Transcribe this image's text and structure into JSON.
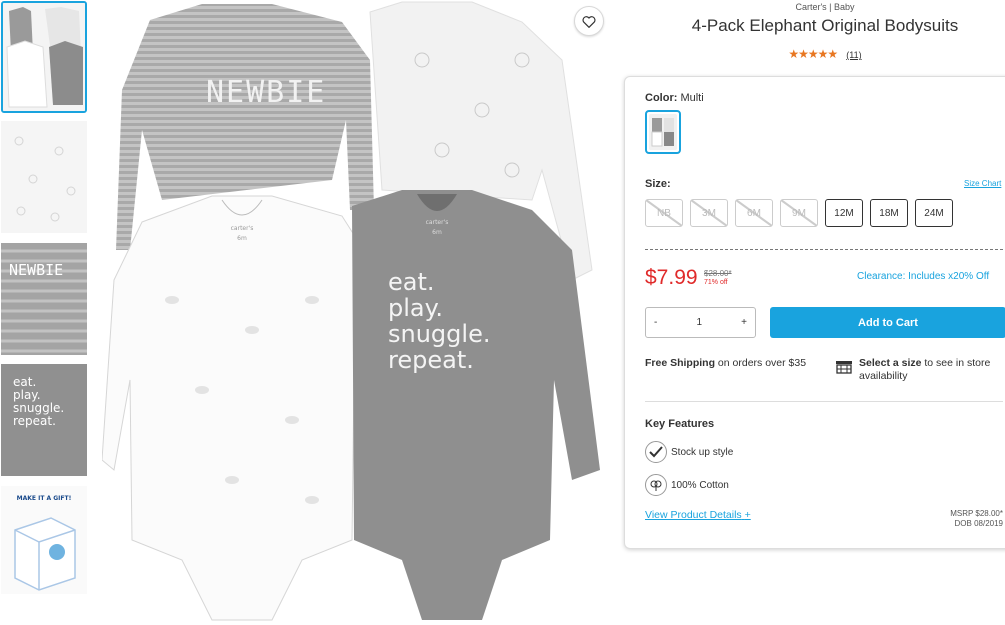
{
  "product": {
    "brand": "Carter's | Baby",
    "title": "4-Pack Elephant Original Bodysuits",
    "rating": 4.5,
    "stars": "★★★★★",
    "review_count": "(11)"
  },
  "garment_prints": {
    "newbie": "NEWBIE",
    "eat_play": [
      "eat.",
      "play.",
      "snuggle.",
      "repeat."
    ],
    "label_brand": "carter's",
    "label_size": "6m",
    "gift_title": "MAKE IT A GIFT!"
  },
  "color": {
    "label": "Color:",
    "value": "Multi"
  },
  "size": {
    "label": "Size:",
    "chart_link": "Size Chart",
    "options": [
      {
        "label": "NB",
        "available": false
      },
      {
        "label": "3M",
        "available": false
      },
      {
        "label": "6M",
        "available": false
      },
      {
        "label": "9M",
        "available": false
      },
      {
        "label": "12M",
        "available": true
      },
      {
        "label": "18M",
        "available": true
      },
      {
        "label": "24M",
        "available": true
      }
    ]
  },
  "pricing": {
    "price": "$7.99",
    "original": "$28.00*",
    "discount": "71% off",
    "clearance": "Clearance: Includes x20% Off"
  },
  "cart": {
    "minus": "-",
    "quantity": "1",
    "plus": "+",
    "add_label": "Add to Cart"
  },
  "shipping": {
    "bold": "Free Shipping",
    "text": " on orders over $35"
  },
  "store": {
    "bold": "Select a size",
    "text": " to see in store availability"
  },
  "features": {
    "heading": "Key Features",
    "items": [
      {
        "icon": "checkmark-icon",
        "label": "Stock up style"
      },
      {
        "icon": "cotton-icon",
        "label": "100% Cotton"
      }
    ]
  },
  "details": {
    "link": "View Product Details",
    "plus": "+",
    "msrp": "MSRP $28.00*",
    "dob": "DOB 08/2019"
  },
  "colors": {
    "accent": "#19a3de",
    "sale": "#e02a2a",
    "star": "#e87722"
  }
}
